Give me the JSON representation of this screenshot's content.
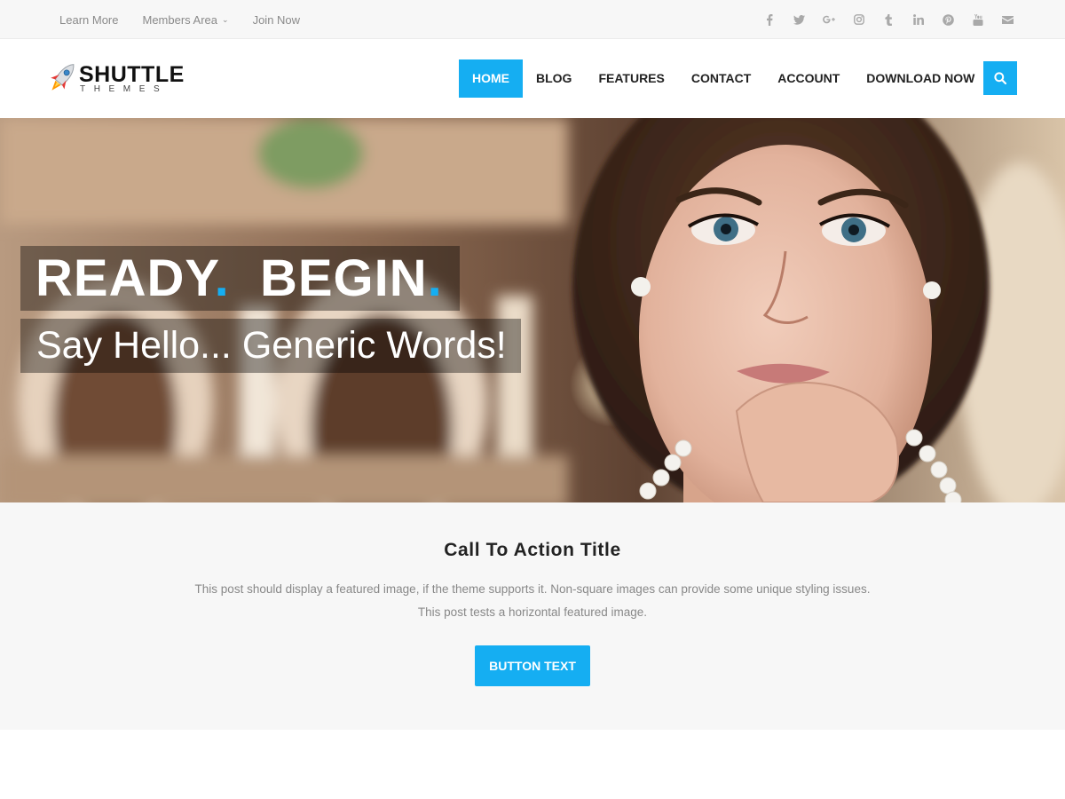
{
  "topbar": {
    "links": [
      {
        "label": "Learn More"
      },
      {
        "label": "Members Area",
        "has_dropdown": true
      },
      {
        "label": "Join Now"
      }
    ],
    "social_icons": [
      "facebook-icon",
      "twitter-icon",
      "google-plus-icon",
      "instagram-icon",
      "tumblr-icon",
      "linkedin-icon",
      "pinterest-icon",
      "youtube-icon",
      "email-icon"
    ]
  },
  "logo": {
    "name": "SHUTTLE",
    "subtitle": "THEMES",
    "icon": "rocket-icon"
  },
  "nav": {
    "items": [
      {
        "label": "HOME",
        "active": true
      },
      {
        "label": "BLOG"
      },
      {
        "label": "FEATURES"
      },
      {
        "label": "CONTACT"
      },
      {
        "label": "ACCOUNT"
      },
      {
        "label": "DOWNLOAD NOW"
      }
    ],
    "search_icon": "search-icon"
  },
  "hero": {
    "title_word_1": "READY",
    "title_word_2": "BEGIN",
    "dot": ".",
    "subtitle": "Say Hello... Generic Words!"
  },
  "cta": {
    "title": "Call To Action Title",
    "text_line_1": "This post should display a featured image, if the theme supports it. Non-square images can provide some unique styling issues.",
    "text_line_2": "This post tests a horizontal featured image.",
    "button_label": "BUTTON TEXT"
  },
  "colors": {
    "accent": "#15aef2",
    "topbar_bg": "#f7f7f7",
    "cta_bg": "#f7f7f7"
  }
}
